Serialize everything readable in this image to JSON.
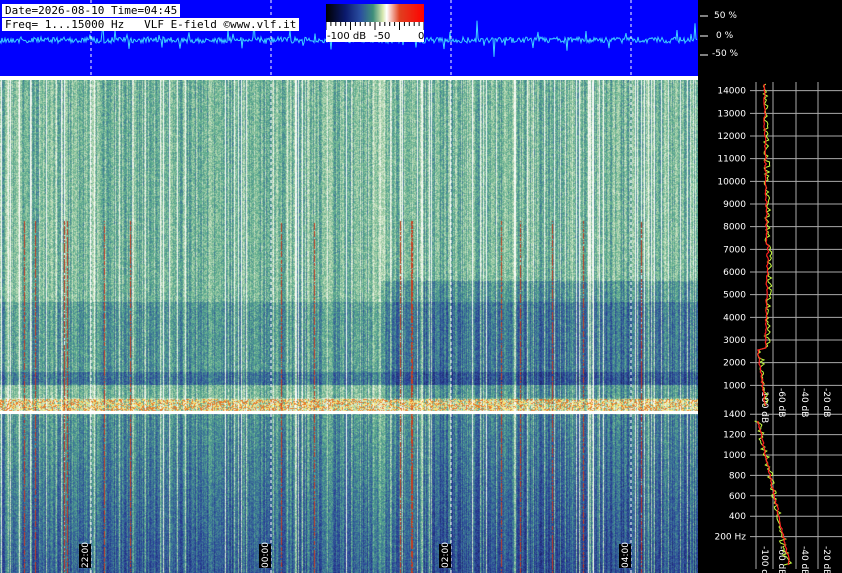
{
  "header": {
    "line1": "Date=2026-08-10 Time=04:45",
    "line2": "Freq= 1...15000 Hz   VLF E-field ©www.vlf.it"
  },
  "colorscale": {
    "label_left": "-100 dB",
    "label_mid": "-50",
    "label_right": "0"
  },
  "amplitude_axis": {
    "labels": [
      "50 %",
      "0 %",
      "-50 %"
    ]
  },
  "upper_freq_ticks": [
    "1000",
    "2000",
    "3000",
    "4000",
    "5000",
    "6000",
    "7000",
    "8000",
    "9000",
    "10000",
    "11000",
    "12000",
    "13000",
    "14000"
  ],
  "lower_freq_ticks": [
    "200 Hz",
    "400",
    "600",
    "800",
    "1000",
    "1200",
    "1400"
  ],
  "db_ticks": [
    "-100 dB",
    "-60 dB",
    "-40 dB",
    "-20 dB"
  ],
  "time_labels": [
    "22:00",
    "00:00",
    "02:00",
    "04:00"
  ],
  "colors": {
    "waveform_bg": "#0000ff",
    "waveform_line": "#3fd0ff",
    "spectrum_line_green": "#c8ff40",
    "spectrum_line_red": "#ff2020",
    "grid": "#ffffff"
  },
  "chart_data": [
    {
      "type": "line",
      "title": "",
      "ylabel": "",
      "y_ticks": [
        "50 %",
        "0 %",
        "-50 %"
      ],
      "ylim": [
        -75,
        75
      ]
    },
    {
      "type": "heatmap",
      "title": "",
      "x_ticks": [
        "22:00",
        "00:00",
        "02:00",
        "04:00"
      ],
      "y_ticks": [
        "1000",
        "2000",
        "3000",
        "4000",
        "5000",
        "6000",
        "7000",
        "8000",
        "9000",
        "10000",
        "11000",
        "12000",
        "13000",
        "14000"
      ],
      "ylim": [
        0,
        15000
      ],
      "colorbar": {
        "ticks": [
          "-100 dB",
          "-50",
          "0"
        ],
        "range_db": [
          -100,
          0
        ]
      }
    },
    {
      "type": "heatmap",
      "title": "",
      "x_ticks": [
        "22:00",
        "00:00",
        "02:00",
        "04:00"
      ],
      "y_ticks": [
        "200 Hz",
        "400",
        "600",
        "800",
        "1000",
        "1200",
        "1400"
      ],
      "ylim": [
        0,
        1500
      ]
    },
    {
      "type": "line",
      "title": "",
      "x_ticks": [
        "-100 dB",
        "-60 dB",
        "-40 dB",
        "-20 dB"
      ],
      "y_ticks": [
        "1000",
        "2000",
        "3000",
        "4000",
        "5000",
        "6000",
        "7000",
        "8000",
        "9000",
        "10000",
        "11000",
        "12000",
        "13000",
        "14000"
      ]
    }
  ]
}
